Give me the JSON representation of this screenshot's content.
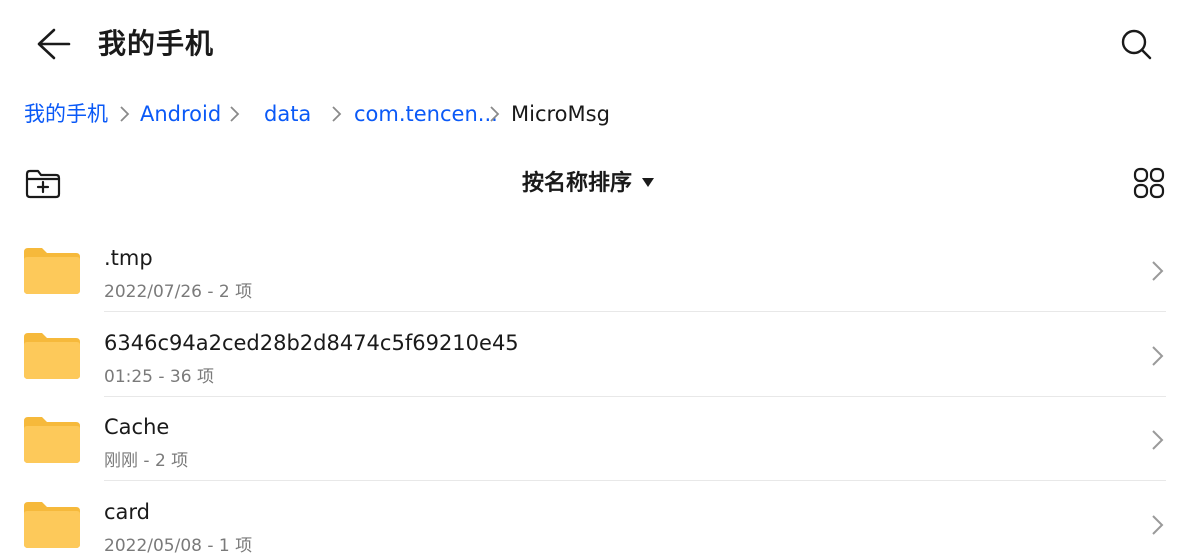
{
  "header": {
    "title": "我的手机",
    "back_icon": "arrow-left-icon",
    "search_icon": "search-icon"
  },
  "breadcrumb": [
    {
      "label": "我的手机"
    },
    {
      "label": "Android"
    },
    {
      "label": "data"
    },
    {
      "label": "com.tencen..."
    },
    {
      "label": "MicroMsg"
    }
  ],
  "toolbar": {
    "sort_label": "按名称排序",
    "new_folder_icon": "folder-add-icon",
    "view_icon": "grid-view-icon"
  },
  "files": [
    {
      "name": ".tmp",
      "meta": "2022/07/26 - 2 项"
    },
    {
      "name": "6346c94a2ced28b2d8474c5f69210e45",
      "meta": "01:25 - 36 项"
    },
    {
      "name": "Cache",
      "meta": "刚刚 - 2 项"
    },
    {
      "name": "card",
      "meta": "2022/05/08 - 1 项"
    }
  ],
  "colors": {
    "accent": "#0a59f7",
    "folder": "#fdc95a",
    "folder_tab": "#f6b93b",
    "secondary_text": "#7a7a7a"
  }
}
